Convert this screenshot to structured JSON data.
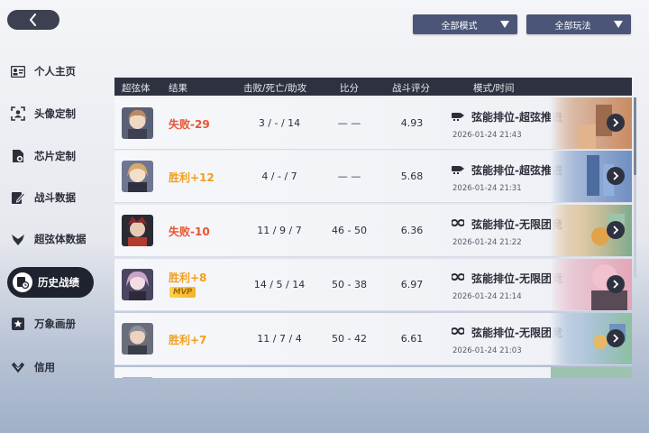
{
  "header": {
    "back_icon": "chevron-left-icon",
    "filters": [
      {
        "label": "全部模式"
      },
      {
        "label": "全部玩法"
      }
    ]
  },
  "sidebar": {
    "items": [
      {
        "label": "个人主页",
        "icon": "id-card-icon",
        "active": false
      },
      {
        "label": "头像定制",
        "icon": "portrait-frame-icon",
        "active": false
      },
      {
        "label": "芯片定制",
        "icon": "chip-icon",
        "active": false
      },
      {
        "label": "战斗数据",
        "icon": "document-edit-icon",
        "active": false
      },
      {
        "label": "超弦体数据",
        "icon": "emblem-icon",
        "active": false
      },
      {
        "label": "历史战绩",
        "icon": "history-record-icon",
        "active": true
      },
      {
        "label": "万象画册",
        "icon": "album-star-icon",
        "active": false
      },
      {
        "label": "信用",
        "icon": "wings-badge-icon",
        "active": false
      }
    ]
  },
  "table": {
    "columns": [
      "超弦体",
      "结果",
      "击败/死亡/助攻",
      "比分",
      "战斗评分",
      "模式/时间"
    ],
    "rows": [
      {
        "result": "失败-29",
        "outcome": "lose",
        "mvp": "",
        "kda": "3 / - / 14",
        "score": "— —",
        "rating": "4.93",
        "mode_icon": "rocket-icon",
        "mode": "弦能排位-超弦推进",
        "time": "2026-01-24 21:43",
        "avatar_color": "#b98a63",
        "thumb_color": "#c98b62"
      },
      {
        "result": "胜利+12",
        "outcome": "win",
        "mvp": "",
        "kda": "4 / - / 7",
        "score": "— —",
        "rating": "5.68",
        "mode_icon": "rocket-icon",
        "mode": "弦能排位-超弦推进",
        "time": "2026-01-24 21:31",
        "avatar_color": "#d6a86a",
        "thumb_color": "#6f8fc2"
      },
      {
        "result": "失败-10",
        "outcome": "lose",
        "mvp": "",
        "kda": "11 / 9 / 7",
        "score": "46 - 50",
        "rating": "6.36",
        "mode_icon": "infinity-icon",
        "mode": "弦能排位-无限团竞",
        "time": "2026-01-24 21:22",
        "avatar_color": "#8b2a2a",
        "thumb_color": "#d2a45e"
      },
      {
        "result": "胜利+8",
        "outcome": "win",
        "mvp": "MVP",
        "kda": "14 / 5 / 14",
        "score": "50 - 38",
        "rating": "6.97",
        "mode_icon": "infinity-icon",
        "mode": "弦能排位-无限团竞",
        "time": "2026-01-24 21:14",
        "avatar_color": "#c9a3c9",
        "thumb_color": "#e3a6b8"
      },
      {
        "result": "胜利+7",
        "outcome": "win",
        "mvp": "",
        "kda": "11 / 7 / 4",
        "score": "50 - 42",
        "rating": "6.61",
        "mode_icon": "infinity-icon",
        "mode": "弦能排位-无限团竞",
        "time": "2026-01-24 21:03",
        "avatar_color": "#8e8f9a",
        "thumb_color": "#7fa2c9"
      }
    ]
  }
}
